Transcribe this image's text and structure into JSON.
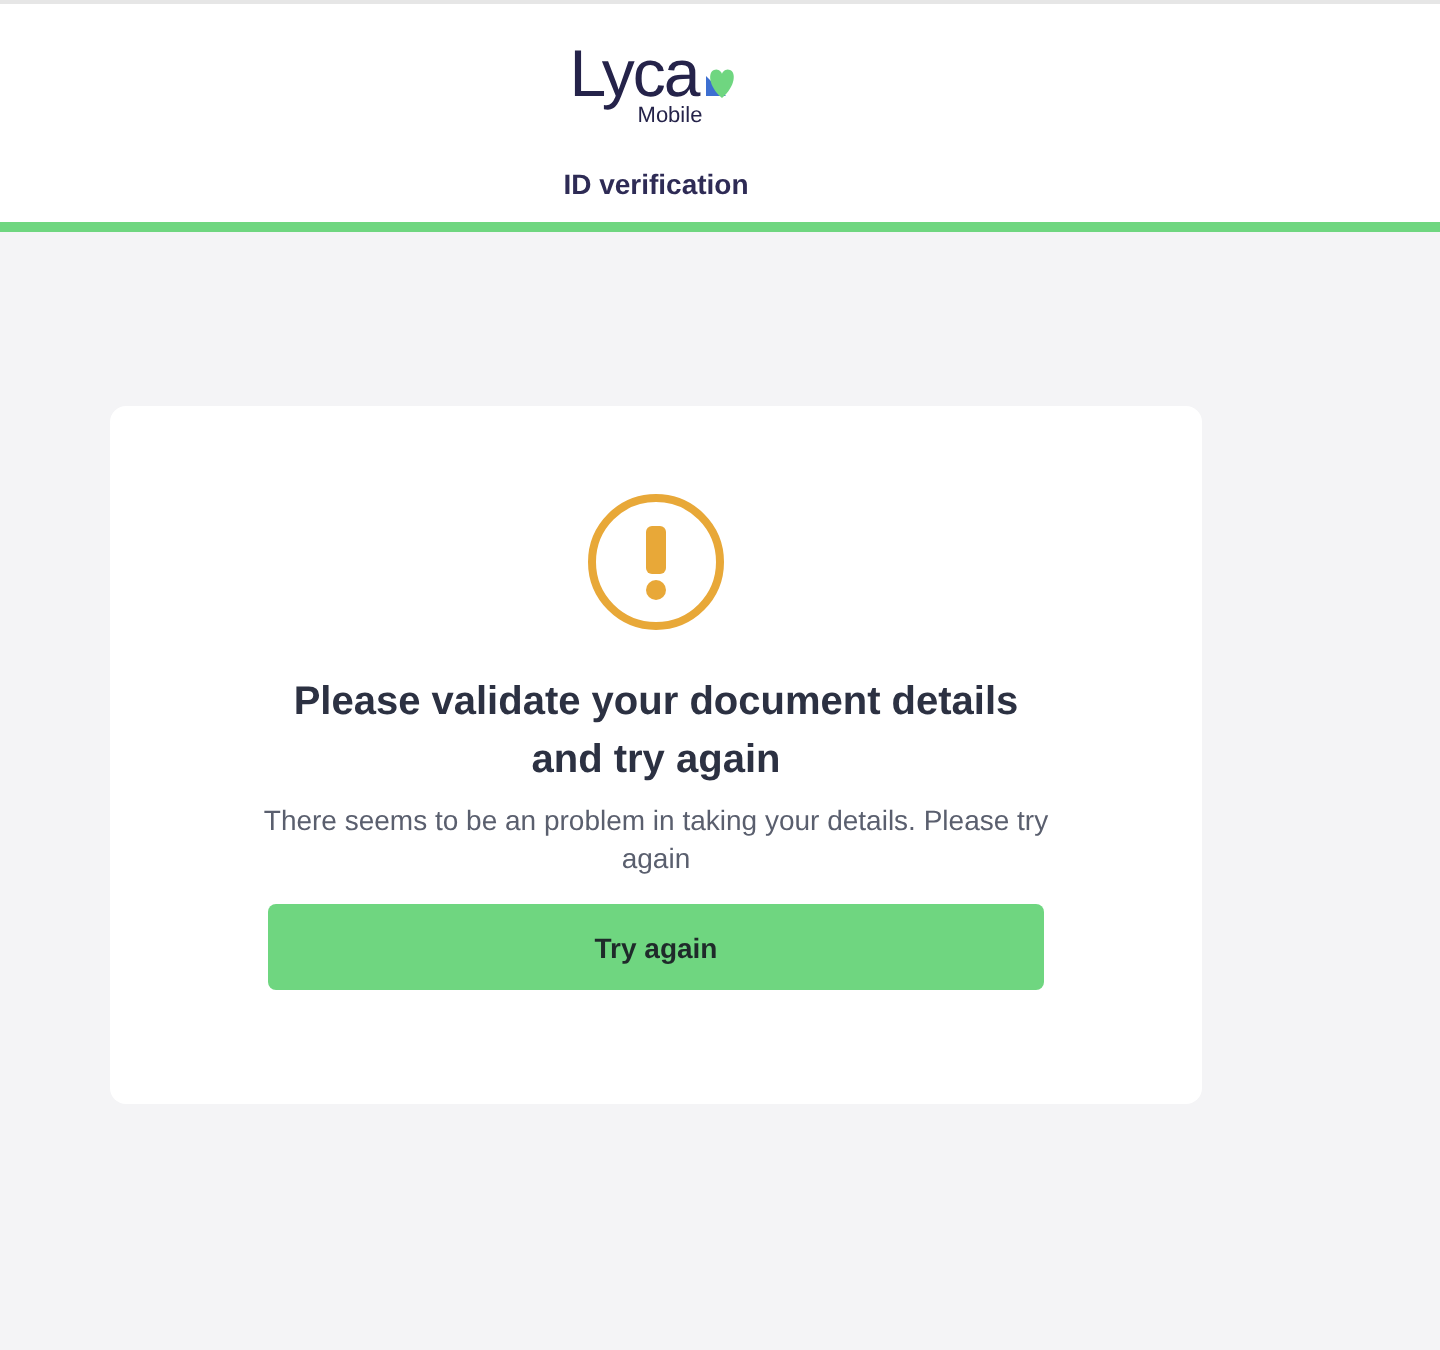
{
  "header": {
    "logo": {
      "brand": "Lyca",
      "sub": "Mobile"
    },
    "title": "ID verification"
  },
  "card": {
    "heading": "Please validate your document details and try again",
    "message": "There seems to be an problem in taking your details. Please try again",
    "button": "Try again"
  }
}
